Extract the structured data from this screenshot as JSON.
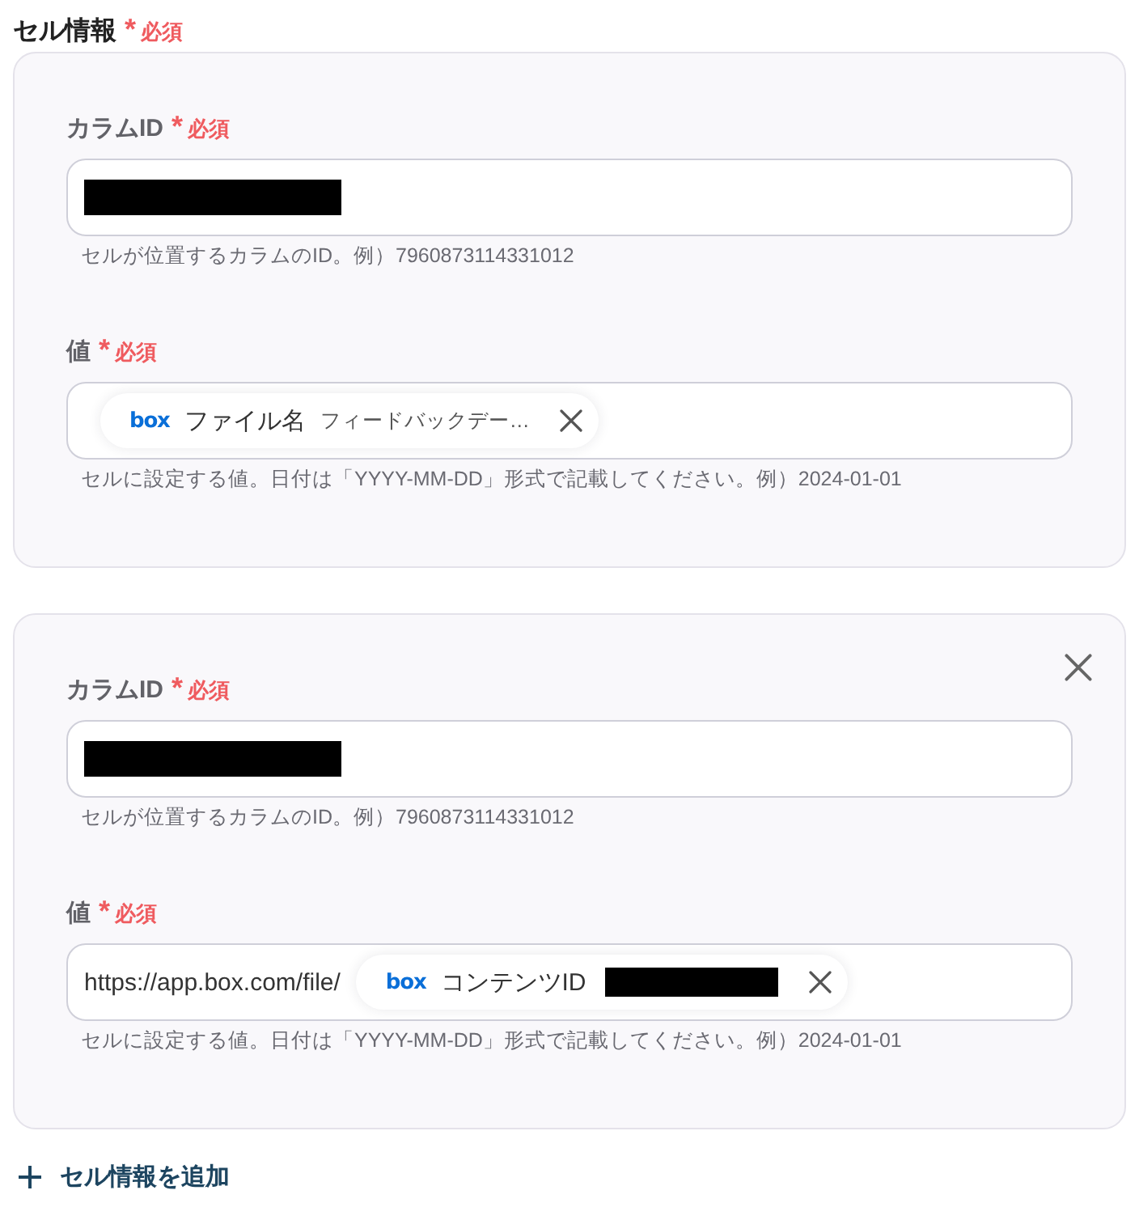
{
  "section": {
    "title": "セル情報",
    "required_mark": "*",
    "required_label": "必須"
  },
  "cells": [
    {
      "removable": false,
      "fields": [
        {
          "label": "カラムID",
          "required_mark": "*",
          "required_label": "必須",
          "content": [
            {
              "kind": "redacted"
            }
          ],
          "hint": "セルが位置するカラムのID。例）7960873114331012"
        },
        {
          "label": "値",
          "required_mark": "*",
          "required_label": "必須",
          "content": [
            {
              "kind": "chip",
              "logo": "box",
              "name": "ファイル名",
              "preview": "フィードバックデー…"
            }
          ],
          "hint": "セルに設定する値。日付は「YYYY-MM-DD」形式で記載してください。例）2024-01-01"
        }
      ]
    },
    {
      "removable": true,
      "fields": [
        {
          "label": "カラムID",
          "required_mark": "*",
          "required_label": "必須",
          "content": [
            {
              "kind": "redacted"
            }
          ],
          "hint": "セルが位置するカラムのID。例）7960873114331012"
        },
        {
          "label": "値",
          "required_mark": "*",
          "required_label": "必須",
          "content": [
            {
              "kind": "text",
              "text": "https://app.box.com/file/"
            },
            {
              "kind": "chip",
              "logo": "box",
              "name": "コンテンツID",
              "preview_redacted": true
            }
          ],
          "hint": "セルに設定する値。日付は「YYYY-MM-DD」形式で記載してください。例）2024-01-01"
        }
      ]
    }
  ],
  "add_button": {
    "label": "セル情報を追加"
  }
}
